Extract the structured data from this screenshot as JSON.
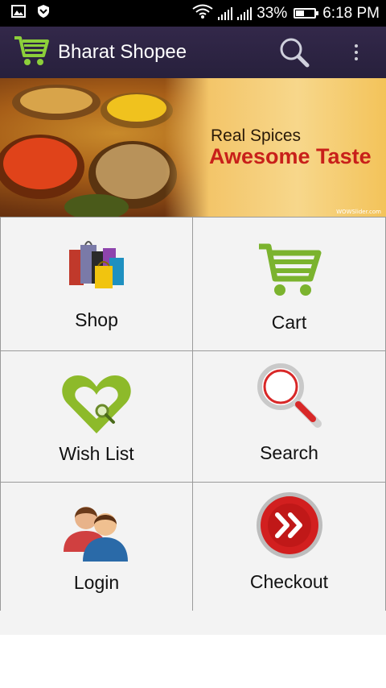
{
  "status_bar": {
    "battery": "33%",
    "time": "6:18 PM",
    "icons": [
      "image-icon",
      "shield-icon",
      "wifi-icon",
      "signal-icon",
      "signal-icon",
      "battery-icon"
    ]
  },
  "app_bar": {
    "title": "Bharat Shopee",
    "icons": [
      "cart-logo-icon",
      "search-icon",
      "overflow-menu-icon"
    ]
  },
  "banner": {
    "line1": "Real Spices",
    "line2": "Awesome Taste",
    "watermark": "WOWSlider.com"
  },
  "menu": {
    "shop": "Shop",
    "cart": "Cart",
    "wishlist": "Wish List",
    "search": "Search",
    "login": "Login",
    "checkout": "Checkout"
  },
  "colors": {
    "app_bar": "#2d2443",
    "accent_green": "#7bb32e",
    "checkout_red": "#d21f1f",
    "banner_red": "#c8201a"
  }
}
